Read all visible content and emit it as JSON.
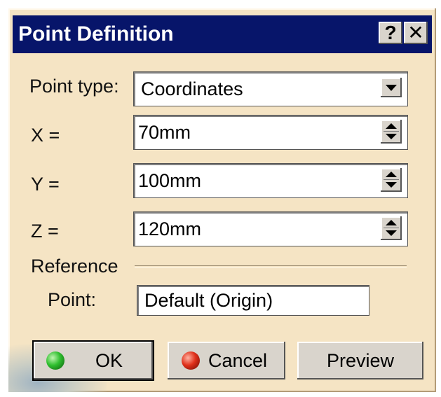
{
  "window": {
    "title": "Point Definition",
    "help_label": "?",
    "close_label": "✕"
  },
  "form": {
    "point_type_label": "Point type:",
    "point_type_value": "Coordinates",
    "x_label": "X =",
    "x_value": "70mm",
    "y_label": "Y =",
    "y_value": "100mm",
    "z_label": "Z =",
    "z_value": "120mm"
  },
  "reference": {
    "group_label": "Reference",
    "point_label": "Point:",
    "point_value": "Default (Origin)"
  },
  "buttons": {
    "ok_label": "OK",
    "cancel_label": "Cancel",
    "preview_label": "Preview"
  },
  "colors": {
    "titlebar": "#07156a",
    "dialog_bg": "#f5e4c4",
    "button_bg": "#d9d4cc",
    "ok_indicator": "#2fbf2f",
    "cancel_indicator": "#e0301a"
  },
  "icons": {
    "ok": "green-indicator-icon",
    "cancel": "red-indicator-icon"
  }
}
